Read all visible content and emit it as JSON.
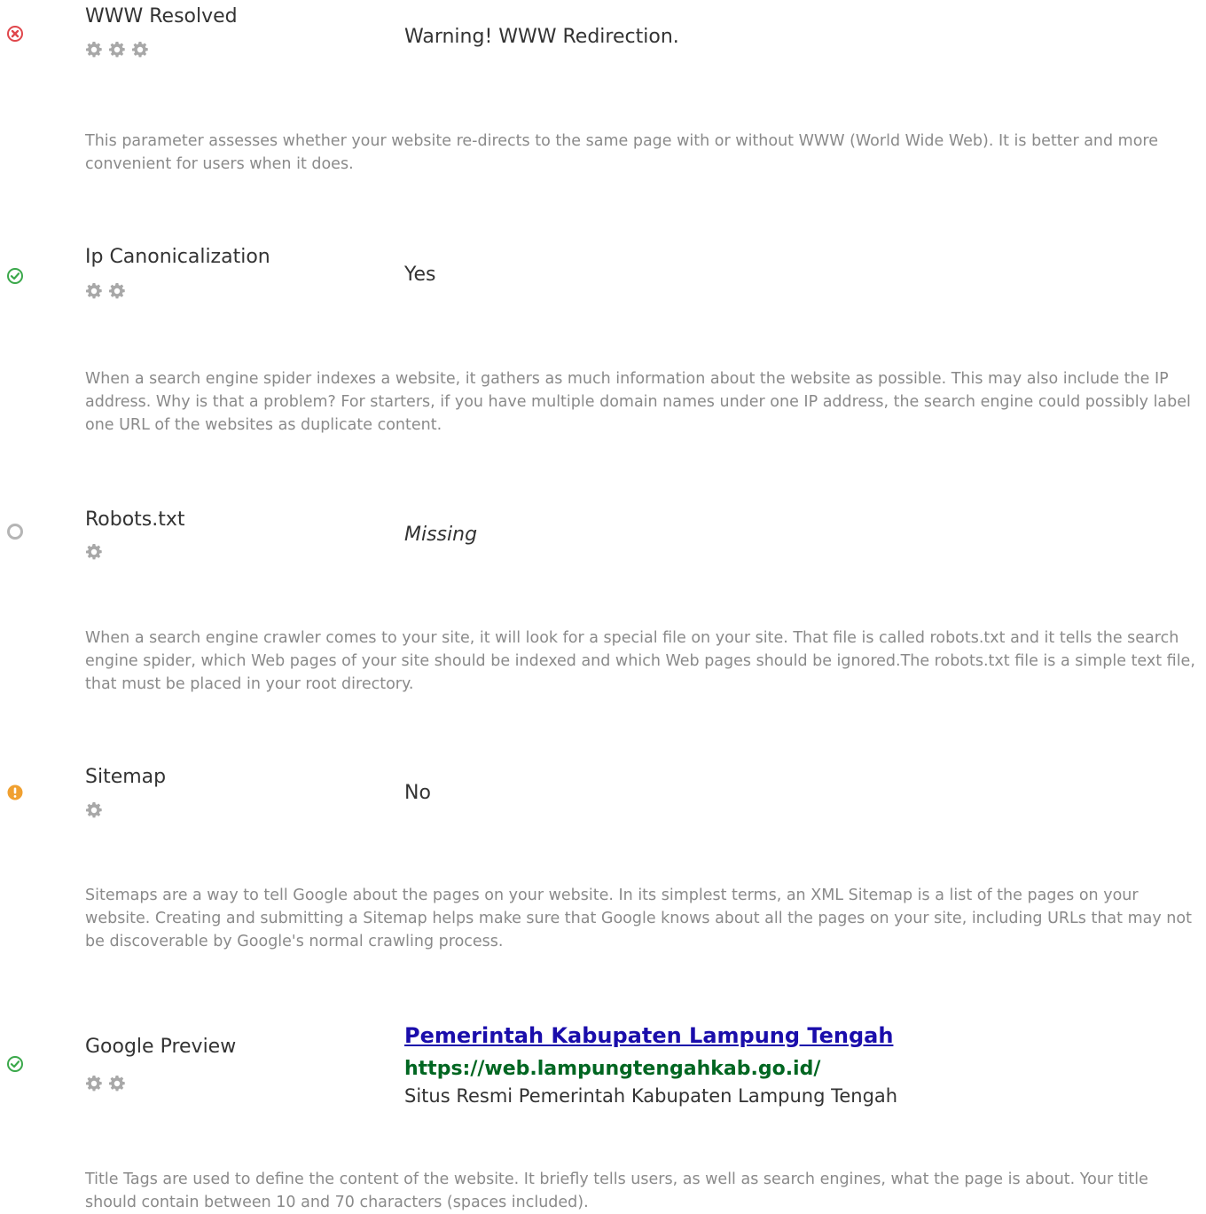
{
  "sections": [
    {
      "title": "WWW Resolved",
      "status": "error",
      "status_icon": "error-x-icon",
      "gear_count": 3,
      "value": "Warning! WWW Redirection.",
      "description": "This parameter assesses whether your website re-directs to the same page with or without WWW (World Wide Web). It is better and more convenient for users when it does."
    },
    {
      "title": "Ip Canonicalization",
      "status": "pass",
      "status_icon": "check-circle-icon",
      "gear_count": 2,
      "value": "Yes",
      "description": "When a search engine spider indexes a website, it gathers as much information about the website as possible. This may also include the IP address. Why is that a problem? For starters, if you have multiple domain names under one IP address, the search engine could possibly label one URL of the websites as duplicate content."
    },
    {
      "title": "Robots.txt",
      "status": "neutral",
      "status_icon": "neutral-circle-icon",
      "gear_count": 1,
      "value": "Missing",
      "description": "When a search engine crawler comes to your site, it will look for a special file on your site. That file is called robots.txt and it tells the search engine spider, which Web pages of your site should be indexed and which Web pages should be ignored.The robots.txt file is a simple text file, that must be placed in your root directory."
    },
    {
      "title": "Sitemap",
      "status": "warning",
      "status_icon": "warning-exclamation-icon",
      "gear_count": 1,
      "value": "No",
      "description": "Sitemaps are a way to tell Google about the pages on your website. In its simplest terms, an XML Sitemap is a list of the pages on your website. Creating and submitting a Sitemap helps make sure that Google knows about all the pages on your site, including URLs that may not be discoverable by Google's normal crawling process."
    },
    {
      "title": "Google Preview",
      "status": "pass",
      "status_icon": "check-circle-icon",
      "gear_count": 2,
      "preview": {
        "title": "Pemerintah Kabupaten Lampung Tengah",
        "url": "https://web.lampungtengahkab.go.id/",
        "description": "Situs Resmi Pemerintah Kabupaten Lampung Tengah"
      },
      "description": "Title Tags are used to define the content of the website. It briefly tells users, as well as search engines, what the page is about. Your title should contain between 10 and 70 characters (spaces included)."
    }
  ],
  "colors": {
    "error": "#e0464b",
    "pass": "#3aa84a",
    "neutral": "#b5b5b5",
    "warning": "#f0a030",
    "gear": "#a8a8a8",
    "description_text": "#8a8a8a",
    "link": "#1a0dab",
    "url": "#006621"
  }
}
